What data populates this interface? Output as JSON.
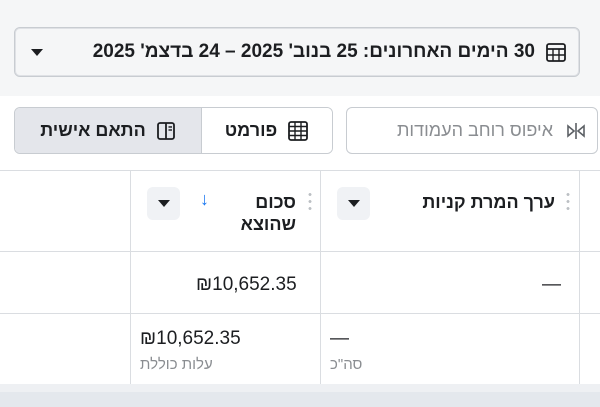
{
  "date_range": {
    "label": "30 הימים האחרונים: 25 בנוב' 2025 – 24 בדצמ' 2025"
  },
  "toolbar": {
    "customize_label": "התאם אישית",
    "format_label": "פורמט",
    "reset_widths_label": "איפוס רוחב העמודות"
  },
  "table": {
    "columns": [
      {
        "title": "ערך המרת קניות"
      },
      {
        "title_line1": "סכום",
        "title_line2": "שהוצא"
      }
    ],
    "rows": [
      {
        "purchase_value": "—",
        "amount_spent": "₪10,652.35"
      }
    ],
    "summary": {
      "purchase_value": "—",
      "purchase_value_sub": "סה\"כ",
      "amount_spent": "₪10,652.35",
      "amount_spent_sub": "עלות כוללת"
    }
  },
  "colors": {
    "accent": "#1877f2",
    "border": "#c8ccd1",
    "muted_text": "#8a8d91"
  }
}
